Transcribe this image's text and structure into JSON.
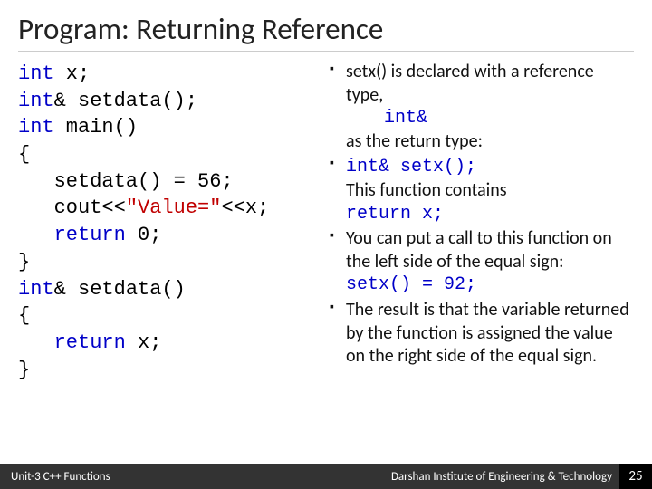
{
  "title": "Program: Returning Reference",
  "code": {
    "l1a": "int",
    "l1b": " x;",
    "l2a": "int",
    "l2b": "& setdata();",
    "l3a": "int",
    "l3b": " main()",
    "l4": "{",
    "l5": "   setdata() = 56;",
    "l6a": "   cout<<",
    "l6b": "\"Value=\"",
    "l6c": "<<x;",
    "l7a": "   ",
    "l7b": "return",
    "l7c": " 0;",
    "l8": "}",
    "l9a": "int",
    "l9b": "& setdata()",
    "l10": "{",
    "l11a": "   ",
    "l11b": "return",
    "l11c": " x;",
    "l12": "}"
  },
  "bullets": {
    "b1": {
      "text1": "setx() is declared with a reference type,",
      "code": "int&",
      "text2": "as the return type:"
    },
    "b2": {
      "code1": "int& setx();",
      "text1": "This function contains",
      "code2": "return x;"
    },
    "b3": {
      "text1": "You can put a call to this function on the left side of the equal sign:",
      "code1": "setx() = 92;"
    },
    "b4": {
      "text1": "The result is that the variable returned by the function is assigned the value on the right side of the equal sign."
    }
  },
  "footer": {
    "left": "Unit-3 C++ Functions",
    "right": "Darshan Institute of Engineering & Technology",
    "page": "25"
  }
}
